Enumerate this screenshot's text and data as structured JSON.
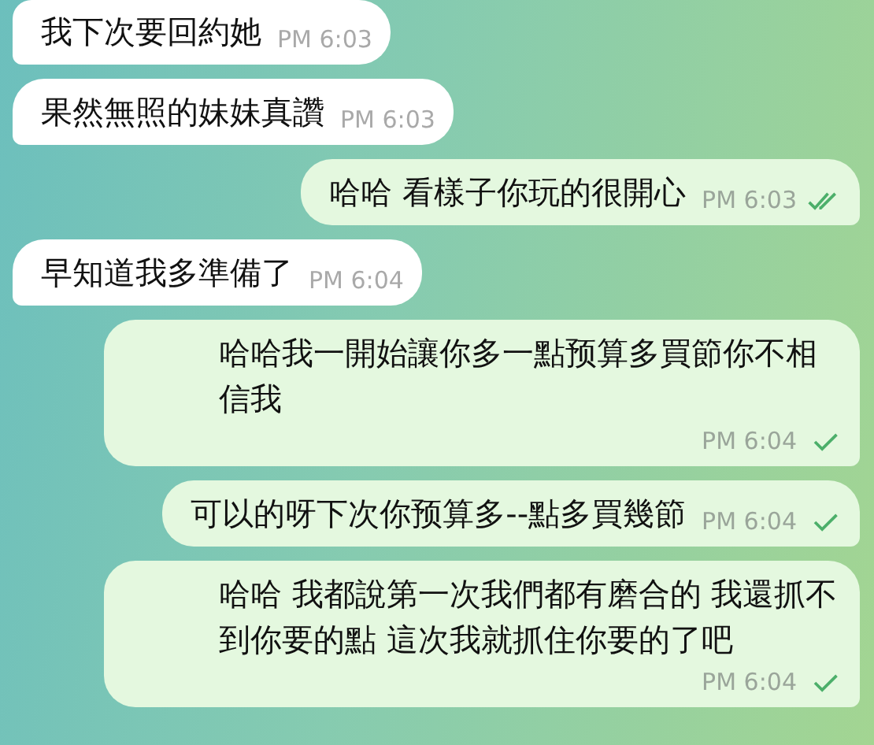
{
  "messages": [
    {
      "kind": "incoming",
      "text": "我下次要回約她",
      "time": "PM 6:03"
    },
    {
      "kind": "incoming",
      "text": "果然無照的妹妹真讚",
      "time": "PM 6:03"
    },
    {
      "kind": "outgoing",
      "text": "哈哈 看樣子你玩的很開心",
      "time": "PM 6:03",
      "read": true
    },
    {
      "kind": "incoming",
      "text": "早知道我多準備了",
      "time": "PM 6:04"
    },
    {
      "kind": "outgoing",
      "text": "哈哈我一開始讓你多一點预算多買節你不相信我",
      "time": "PM 6:04",
      "read": false
    },
    {
      "kind": "outgoing",
      "text": "可以的呀下次你预算多--點多買幾節",
      "time": "PM 6:04",
      "read": false
    },
    {
      "kind": "outgoing",
      "text": "哈哈 我都說第一次我們都有磨合的 我還抓不到你要的點 這次我就抓住你要的了吧",
      "time": "PM 6:04",
      "read": false
    }
  ]
}
